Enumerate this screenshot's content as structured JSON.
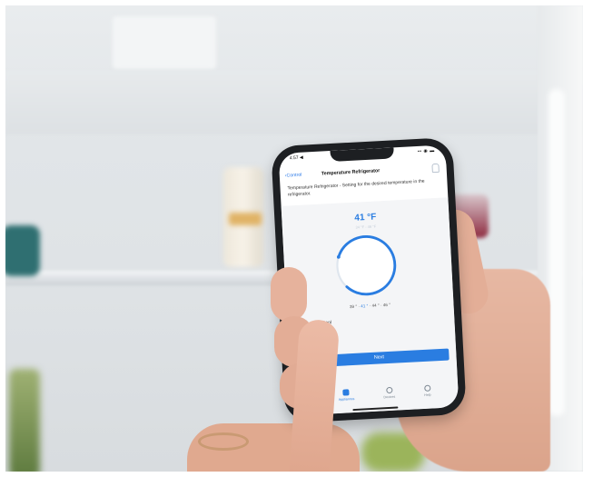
{
  "photo": {
    "description": "fridge-interior-with-hand-holding-smartphone"
  },
  "status_bar": {
    "time": "4:57 ◀",
    "icons": "▪▪ ◉ ▬"
  },
  "app": {
    "back_label": "Control",
    "title": "Temperature Refrigerator",
    "description": "Temperature Refrigerator - Setting for the desired temperature in the refrigerator.",
    "temperature": "41 °F",
    "temperature_sub": "34 °F - 46 °F",
    "scale": {
      "left": "39 ° ·",
      "active": "41 °",
      "right": "· 44 ° · 46 °"
    },
    "supercool_label": "SuperCool",
    "next_label": "Next",
    "tabs": [
      {
        "label": "Appliances",
        "icon": "appliances-icon",
        "active": true
      },
      {
        "label": "Devices",
        "icon": "devices-icon",
        "active": false
      },
      {
        "label": "Help",
        "icon": "help-icon",
        "active": false
      }
    ],
    "accent_color": "#2a7de1",
    "dial_fraction": 0.82
  }
}
